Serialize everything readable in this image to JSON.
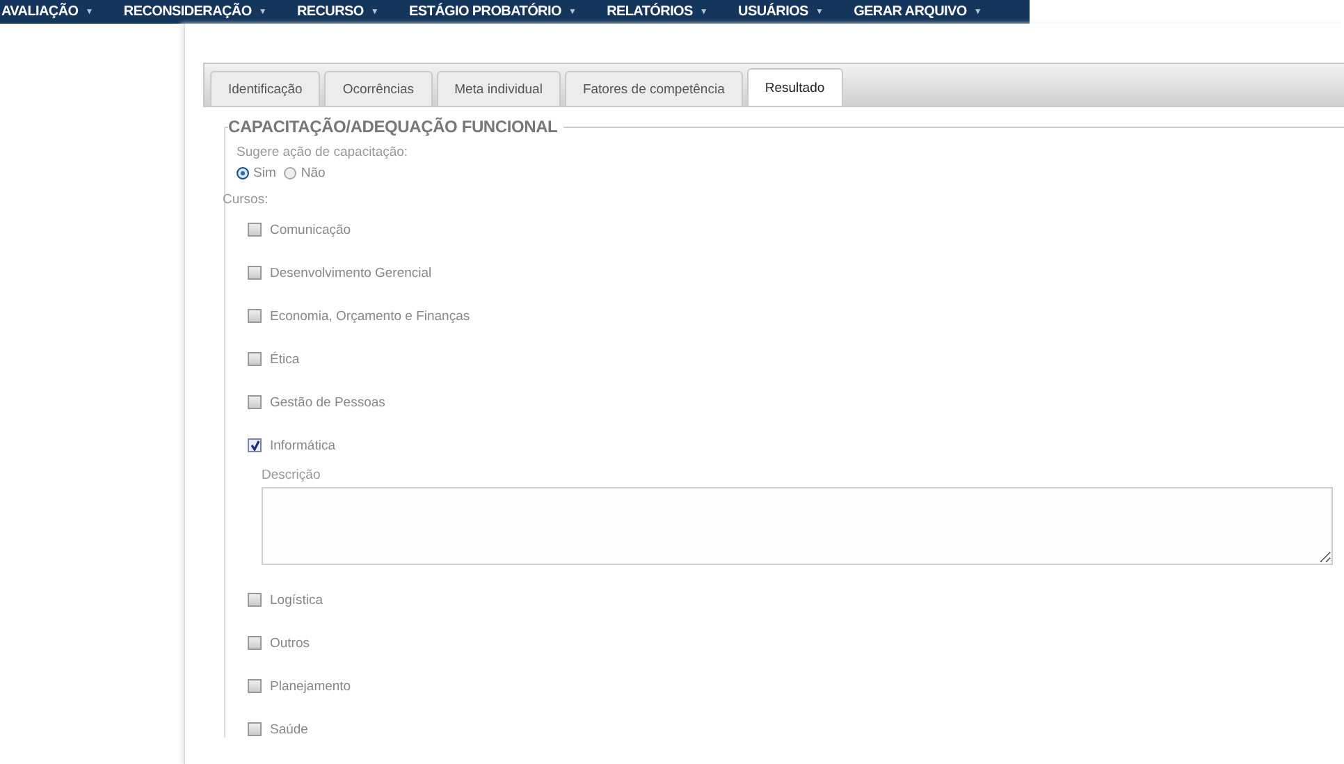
{
  "menu": [
    {
      "label": "AVALIAÇÃO",
      "caret": "▼"
    },
    {
      "label": "RECONSIDERAÇÃO",
      "caret": "▼"
    },
    {
      "label": "RECURSO",
      "caret": "▼"
    },
    {
      "label": "ESTÁGIO PROBATÓRIO",
      "caret": "▼"
    },
    {
      "label": "RELATÓRIOS",
      "caret": "▼"
    },
    {
      "label": "USUÁRIOS",
      "caret": "▼"
    },
    {
      "label": "GERAR ARQUIVO",
      "caret": "▼"
    }
  ],
  "tabs": [
    {
      "label": "Identificação",
      "selected": false
    },
    {
      "label": "Ocorrências",
      "selected": false
    },
    {
      "label": "Meta individual",
      "selected": false
    },
    {
      "label": "Fatores de competência",
      "selected": false
    },
    {
      "label": "Resultado",
      "selected": true
    }
  ],
  "section": {
    "legend": "CAPACITAÇÃO/ADEQUAÇÃO FUNCIONAL",
    "question": "Sugere ação de capacitação:",
    "options": [
      {
        "label": "Sim",
        "selected": true
      },
      {
        "label": "Não",
        "selected": false
      }
    ],
    "courses_label": "Cursos:",
    "courses": [
      {
        "label": "Comunicação",
        "checked": false
      },
      {
        "label": "Desenvolvimento Gerencial",
        "checked": false
      },
      {
        "label": "Economia, Orçamento e Finanças",
        "checked": false
      },
      {
        "label": "Ética",
        "checked": false
      },
      {
        "label": "Gestão de Pessoas",
        "checked": false
      },
      {
        "label": "Informática",
        "checked": true,
        "description": {
          "label": "Descrição"
        }
      },
      {
        "label": "Logística",
        "checked": false
      },
      {
        "label": "Outros",
        "checked": false
      },
      {
        "label": "Planejamento",
        "checked": false
      },
      {
        "label": "Saúde",
        "checked": false
      }
    ]
  }
}
